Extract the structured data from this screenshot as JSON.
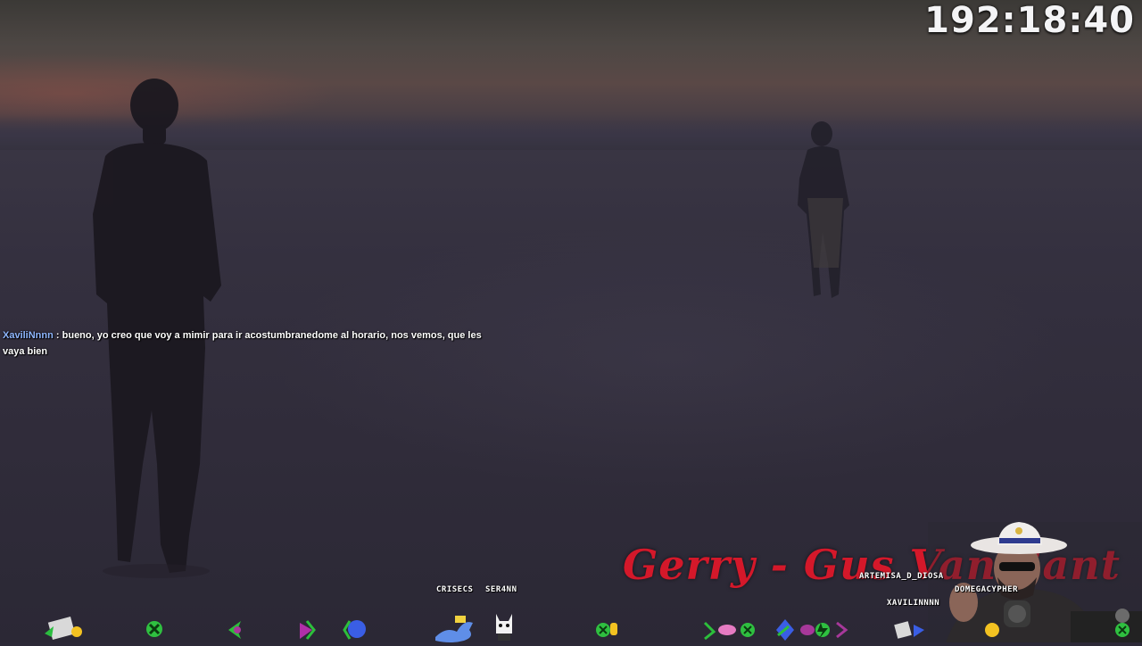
{
  "timer": "192:18:40",
  "chat": {
    "username": "XaviliNnnn",
    "message": ": bueno, yo creo que voy a mimir para ir acostumbranedome al horario, nos vemos, que les vaya bien"
  },
  "song_title": "Gerry - Gus Van Sant",
  "tags": {
    "crisecs": "CRISECS",
    "ser4nn": "SER4NN",
    "artemisa": "ARTEMISA_D_DIOSA",
    "megacypher": "DOMEGACYPHER",
    "xavilinnnn": "XAVILINNNN"
  },
  "colors": {
    "accent_red": "#d4182a",
    "chat_user": "#8fb7ff"
  },
  "emotes": [
    "gift-icon",
    "green-circle-icon",
    "green-arrow-icon",
    "purple-arrow-icon",
    "blue-pink-orb-icon",
    "blue-dragon-icon",
    "white-ghost-icon",
    "green-yellow-icon",
    "pink-gem-icon",
    "blue-crystal-icon",
    "green-bolt-icon"
  ]
}
